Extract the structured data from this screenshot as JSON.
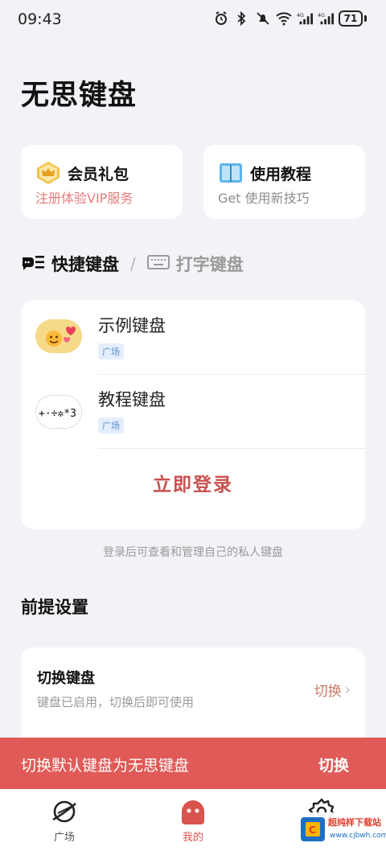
{
  "status_bar": {
    "time": "09:43",
    "battery": "71",
    "icons": [
      "alarm-icon",
      "bluetooth-icon",
      "mute-icon",
      "wifi-icon",
      "signal-4g-icon",
      "signal-4g-icon",
      "battery-icon"
    ]
  },
  "app": {
    "title": "无思键盘"
  },
  "promo": {
    "vip": {
      "title": "会员礼包",
      "subtitle": "注册体验VIP服务",
      "icon": "crown-icon"
    },
    "tutorial": {
      "title": "使用教程",
      "subtitle": "Get 使用新技巧",
      "icon": "book-icon"
    }
  },
  "tabs": {
    "active": "快捷键盘",
    "separator": "/",
    "inactive": "打字键盘"
  },
  "keyboards": [
    {
      "name": "示例键盘",
      "tag": "广场"
    },
    {
      "name": "教程键盘",
      "tag": "广场"
    }
  ],
  "keyboards_login": "立即登录",
  "login_hint": "登录后可查看和管理自己的私人键盘",
  "settings": {
    "section_title": "前提设置",
    "switch_title": "切换键盘",
    "switch_desc": "键盘已启用，切换后即可使用",
    "switch_action": "切换"
  },
  "banner": {
    "text": "切换默认键盘为无思键盘",
    "button": "切换"
  },
  "bottom_nav": [
    {
      "label": "广场",
      "icon": "planet-icon"
    },
    {
      "label": "我的",
      "icon": "profile-icon"
    },
    {
      "label": "",
      "icon": "gear-icon"
    }
  ],
  "watermark": {
    "name": "超纯样下载站",
    "url": "www.cjbwh.com"
  },
  "colors": {
    "accent": "#e05a57",
    "login": "#c8514f",
    "background": "#f3f3f7",
    "tag_bg": "#e4eefb",
    "tag_text": "#5b8fd1"
  }
}
